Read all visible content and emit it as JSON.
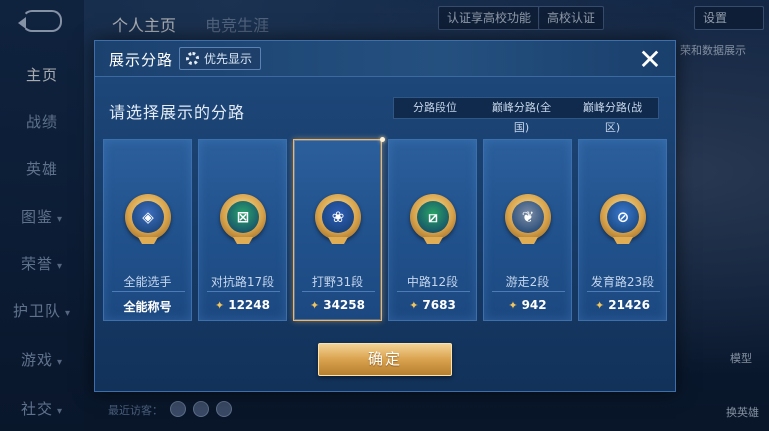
{
  "background": {
    "top_tabs": [
      "个人主页",
      "电竞生涯"
    ],
    "top_buttons": [
      "认证享高校功能",
      "高校认证",
      "设置"
    ],
    "top_right_link": "荣和数据展示",
    "nav_items": [
      {
        "label": "主页",
        "active": true,
        "arrow": false
      },
      {
        "label": "战绩",
        "active": false,
        "arrow": false
      },
      {
        "label": "英雄",
        "active": false,
        "arrow": false
      },
      {
        "label": "图鉴",
        "active": false,
        "arrow": true
      },
      {
        "label": "荣誉",
        "active": false,
        "arrow": true
      },
      {
        "label": "护卫队",
        "active": false,
        "arrow": true
      },
      {
        "label": "游戏",
        "active": false,
        "arrow": true
      },
      {
        "label": "社交",
        "active": false,
        "arrow": true
      }
    ],
    "visitor_label": "最近访客：",
    "right_labels": [
      "模型",
      "换英雄"
    ]
  },
  "dialog": {
    "title": "展示分路",
    "priority_label": "优先显示",
    "close_label": "✕",
    "prompt": "请选择展示的分路",
    "filter_tabs": [
      {
        "label": "分路段位",
        "selected": true
      },
      {
        "label": "巅峰分路(全国)",
        "selected": false
      },
      {
        "label": "巅峰分路(战区)",
        "selected": false
      }
    ],
    "cards": [
      {
        "label": "全能选手",
        "value": "全能称号",
        "icon": "all-round-emblem-icon",
        "glyph": "◈",
        "color": "#3e6fc0",
        "selected": false,
        "show_peak_icon": false
      },
      {
        "label": "对抗路17段",
        "value": "12248",
        "icon": "clash-lane-emblem-icon",
        "glyph": "⊠",
        "color": "#2aa56c",
        "selected": false,
        "show_peak_icon": true
      },
      {
        "label": "打野31段",
        "value": "34258",
        "icon": "jungle-emblem-icon",
        "glyph": "❀",
        "color": "#2f5fb8",
        "selected": true,
        "show_peak_icon": true
      },
      {
        "label": "中路12段",
        "value": "7683",
        "icon": "mid-lane-emblem-icon",
        "glyph": "⧄",
        "color": "#28a466",
        "selected": false,
        "show_peak_icon": true
      },
      {
        "label": "游走2段",
        "value": "942",
        "icon": "roam-emblem-icon",
        "glyph": "❦",
        "color": "#7d8ea8",
        "selected": false,
        "show_peak_icon": true
      },
      {
        "label": "发育路23段",
        "value": "21426",
        "icon": "farm-lane-emblem-icon",
        "glyph": "⊘",
        "color": "#3a7ad0",
        "selected": false,
        "show_peak_icon": true
      }
    ],
    "confirm_label": "确定"
  }
}
